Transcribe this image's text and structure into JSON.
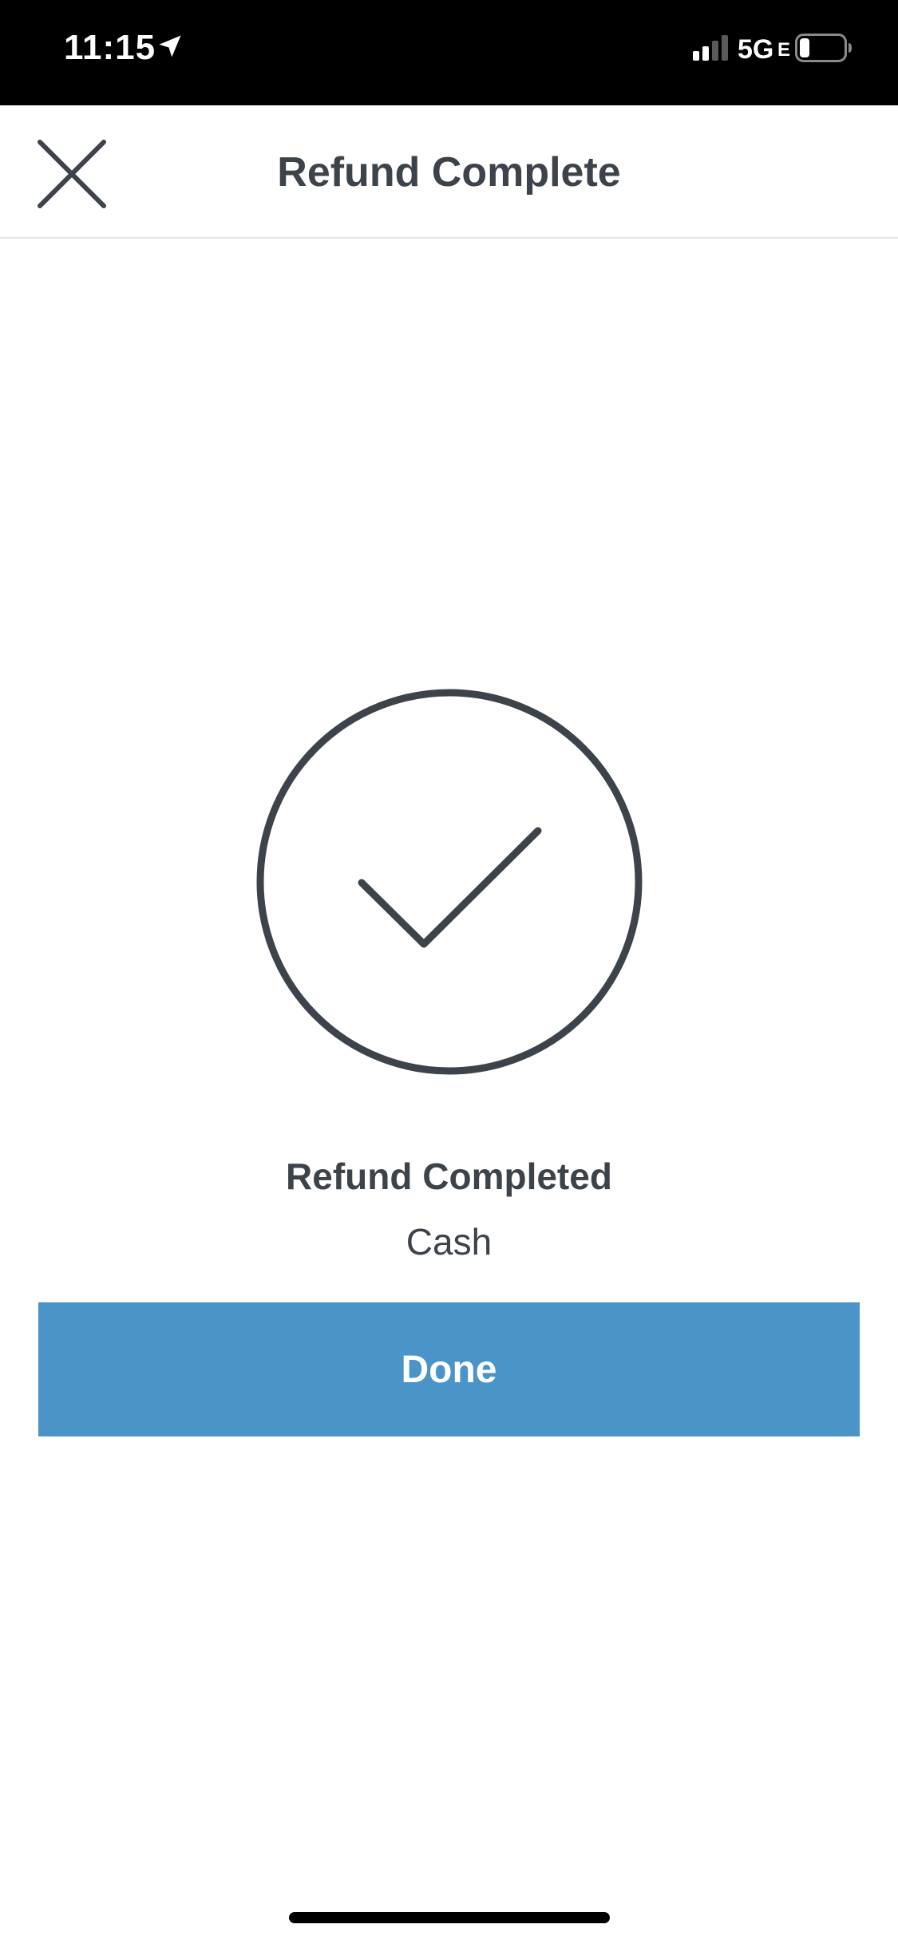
{
  "status_bar": {
    "time": "11:15",
    "network": "5G",
    "network_suffix": "E",
    "icons": [
      "location-arrow-icon",
      "signal-icon",
      "battery-icon"
    ]
  },
  "header": {
    "title": "Refund Complete",
    "close_icon": "close-icon"
  },
  "content": {
    "illustration_icon": "check-circle-icon",
    "title": "Refund Completed",
    "subtitle": "Cash"
  },
  "actions": {
    "done_label": "Done"
  },
  "colors": {
    "primary_button": "#4b94c8",
    "text": "#3d434a",
    "status_bar_bg": "#000000"
  }
}
